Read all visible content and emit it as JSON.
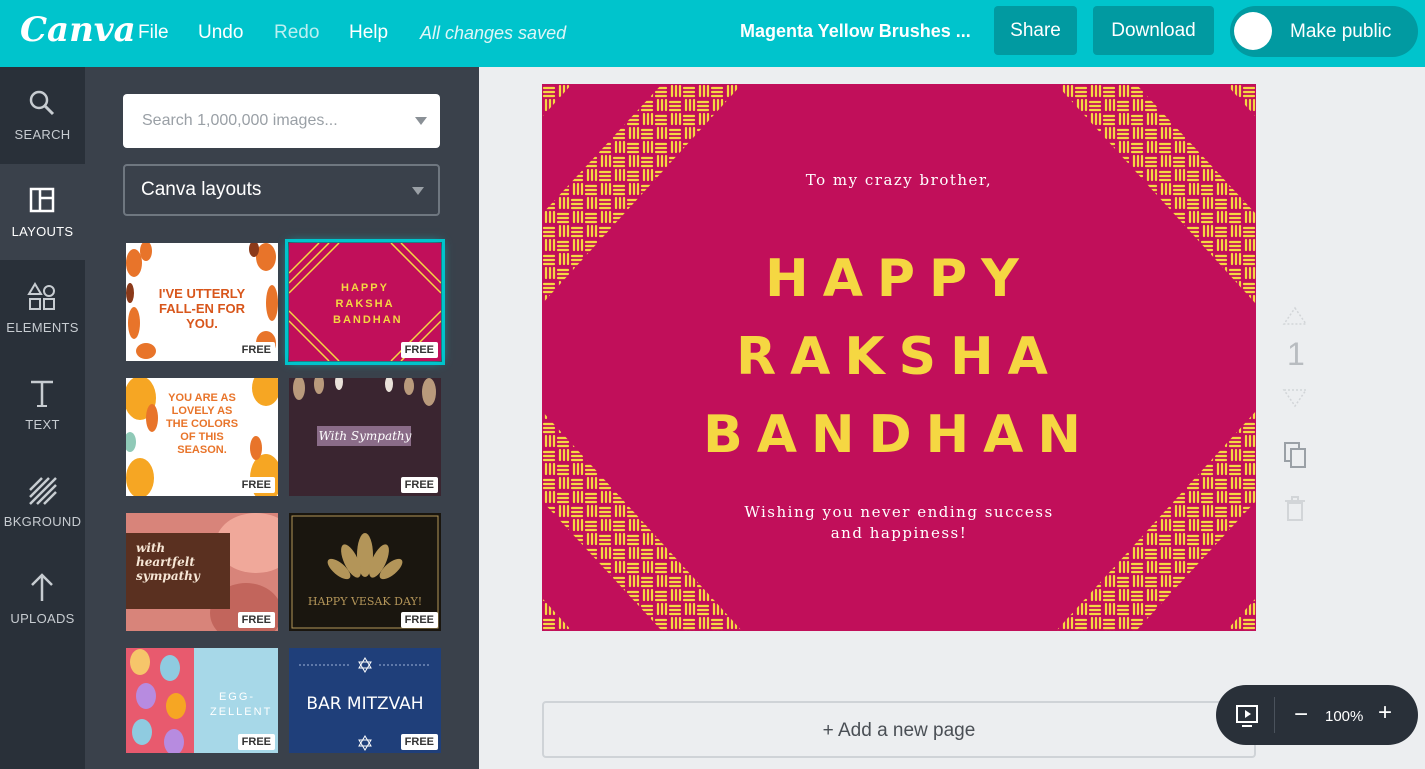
{
  "header": {
    "logo": "Canva",
    "menu": [
      "File",
      "Undo",
      "Redo",
      "Help"
    ],
    "saved_status": "All changes saved",
    "doc_title": "Magenta Yellow Brushes ...",
    "share_label": "Share",
    "download_label": "Download",
    "public_label": "Make public"
  },
  "rail": [
    {
      "label": "SEARCH",
      "icon": "search-icon"
    },
    {
      "label": "LAYOUTS",
      "icon": "layouts-icon"
    },
    {
      "label": "ELEMENTS",
      "icon": "elements-icon"
    },
    {
      "label": "TEXT",
      "icon": "text-icon"
    },
    {
      "label": "BKGROUND",
      "icon": "background-icon"
    },
    {
      "label": "UPLOADS",
      "icon": "upload-icon"
    }
  ],
  "panel": {
    "search_placeholder": "Search 1,000,000 images...",
    "select_value": "Canva layouts",
    "free_badge": "FREE",
    "thumbs": [
      {
        "text": "I'VE UTTERLY FALL-EN FOR YOU."
      },
      {
        "text": "HAPPY RAKSHA BANDHAN"
      },
      {
        "text": "YOU ARE AS LOVELY AS THE COLORS OF THIS SEASON."
      },
      {
        "text": "With Sympathy"
      },
      {
        "text": "with heartfelt sympathy"
      },
      {
        "text": "HAPPY VESAK DAY!"
      },
      {
        "text": "EGG-ZELLENT"
      },
      {
        "text": "BAR MITZVAH"
      }
    ]
  },
  "canvas": {
    "line1": "To my crazy brother,",
    "heading": [
      "HAPPY",
      "RAKSHA",
      "BANDHAN"
    ],
    "line2a": "Wishing you never ending success",
    "line2b": "and happiness!"
  },
  "side": {
    "page_number": "1"
  },
  "add_page_label": "+ Add a new page",
  "zoom": {
    "value": "100%",
    "minus": "−",
    "plus": "+"
  },
  "colors": {
    "brand": "#00c4cc",
    "canvas_bg": "#c10f5a",
    "accent_yellow": "#f5d742"
  }
}
